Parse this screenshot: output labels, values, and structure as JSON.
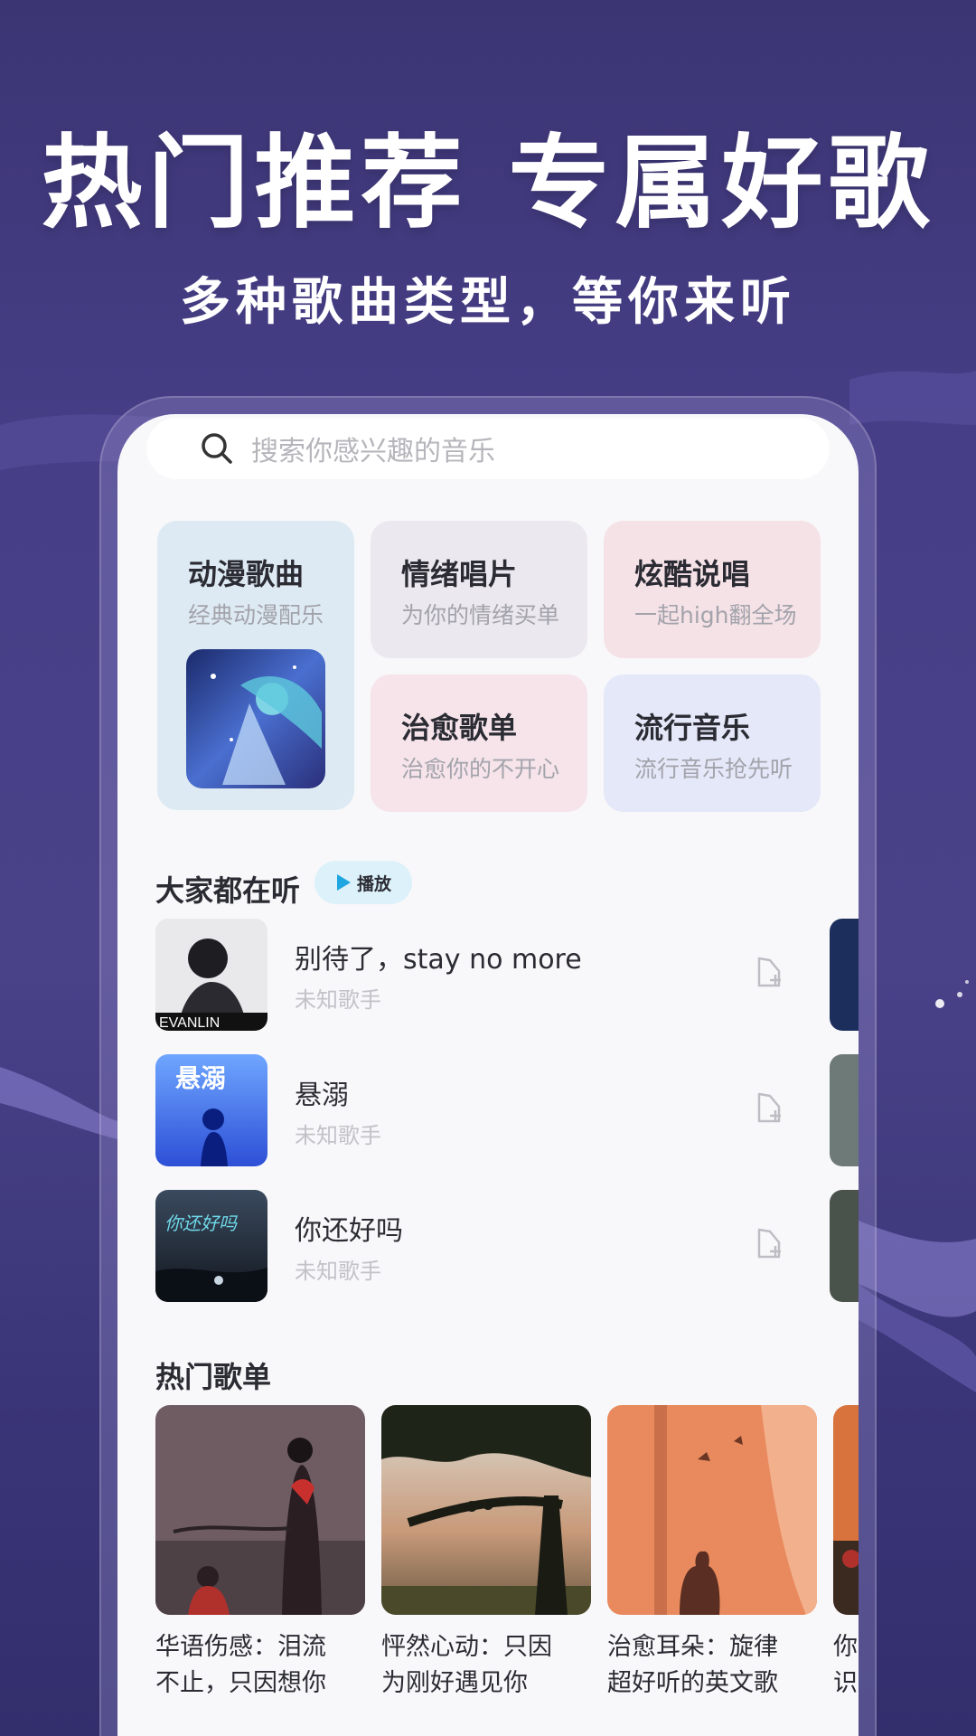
{
  "hero": {
    "title": "热门推荐 专属好歌",
    "subtitle": "多种歌曲类型，等你来听"
  },
  "search": {
    "placeholder": "搜索你感兴趣的音乐"
  },
  "categories": [
    {
      "title": "动漫歌曲",
      "subtitle": "经典动漫配乐"
    },
    {
      "title": "情绪唱片",
      "subtitle": "为你的情绪买单"
    },
    {
      "title": "炫酷说唱",
      "subtitle": "一起high翻全场"
    },
    {
      "title": "治愈歌单",
      "subtitle": "治愈你的不开心"
    },
    {
      "title": "流行音乐",
      "subtitle": "流行音乐抢先听"
    }
  ],
  "listening": {
    "title": "大家都在听",
    "play_label": "播放",
    "songs": [
      {
        "name": "别待了，stay no more",
        "artist": "未知歌手",
        "cover_text": "EVANLIN"
      },
      {
        "name": "悬溺",
        "artist": "未知歌手",
        "cover_text": "悬溺"
      },
      {
        "name": "你还好吗",
        "artist": "未知歌手",
        "cover_text": "你还好吗"
      }
    ]
  },
  "hot_playlists": {
    "title": "热门歌单",
    "items": [
      {
        "line1": "华语伤感：泪流",
        "line2": "不止，只因想你"
      },
      {
        "line1": "怦然心动：只因",
        "line2": "为刚好遇见你"
      },
      {
        "line1": "治愈耳朵：旋律",
        "line2": "超好听的英文歌"
      },
      {
        "line1": "你",
        "line2": "识"
      }
    ]
  },
  "colors": {
    "background": "#463e86",
    "accent_play": "#1fa6e0",
    "card_anime": "#deeaf3",
    "card_mood": "#ece8ef",
    "card_rap": "#f5e2e7",
    "card_heal": "#f6e4ea",
    "card_pop": "#e4e8f8"
  }
}
